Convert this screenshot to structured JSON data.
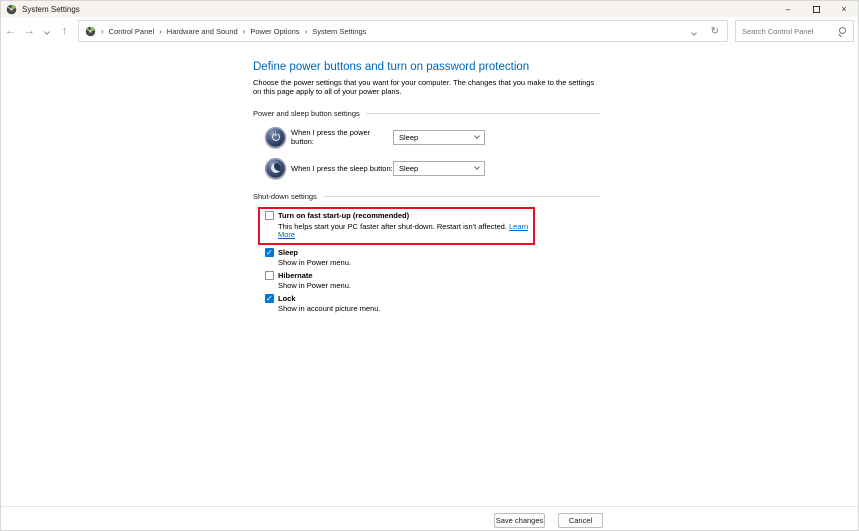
{
  "titlebar": {
    "title": "System Settings",
    "minimize_glyph": "–",
    "close_glyph": "×"
  },
  "navbar": {
    "back_glyph": "←",
    "forward_glyph": "→",
    "up_glyph": "↑",
    "refresh_glyph": "↻",
    "breadcrumb": {
      "separator": "›",
      "items": [
        "Control Panel",
        "Hardware and Sound",
        "Power Options",
        "System Settings"
      ]
    },
    "search_placeholder": "Search Control Panel"
  },
  "content": {
    "heading": "Define power buttons and turn on password protection",
    "description": "Choose the power settings that you want for your computer. The changes that you make to the settings on this page apply to all of your power plans.",
    "power_section": {
      "title": "Power and sleep button settings",
      "rows": [
        {
          "icon": "power-button-icon",
          "label": "When I press the power button:",
          "value": "Sleep"
        },
        {
          "icon": "sleep-button-icon",
          "label": "When I press the sleep button:",
          "value": "Sleep"
        }
      ]
    },
    "shutdown_section": {
      "title": "Shut-down settings",
      "items": [
        {
          "label": "Turn on fast start-up (recommended)",
          "description": "This helps start your PC faster after shut-down. Restart isn't affected.",
          "link": "Learn More",
          "checked": false,
          "highlighted": true
        },
        {
          "label": "Sleep",
          "description": "Show in Power menu.",
          "checked": true
        },
        {
          "label": "Hibernate",
          "description": "Show in Power menu.",
          "checked": false
        },
        {
          "label": "Lock",
          "description": "Show in account picture menu.",
          "checked": true
        }
      ]
    }
  },
  "footer": {
    "save_label": "Save changes",
    "cancel_label": "Cancel"
  },
  "colors": {
    "heading_blue": "#0066b4",
    "link_blue": "#0066cc",
    "checkbox_checked_blue": "#0078d7",
    "highlight_red": "#e81123"
  }
}
